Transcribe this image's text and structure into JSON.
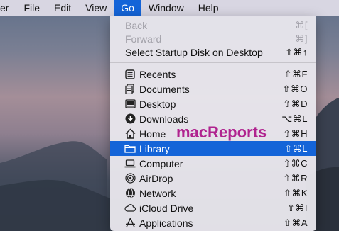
{
  "menubar": {
    "items": [
      {
        "label": "er"
      },
      {
        "label": "File"
      },
      {
        "label": "Edit"
      },
      {
        "label": "View"
      },
      {
        "label": "Go"
      },
      {
        "label": "Window"
      },
      {
        "label": "Help"
      }
    ],
    "active_label": "Go"
  },
  "go_menu": {
    "items": [
      {
        "label": "Back",
        "shortcut": "⌘[",
        "state": "disabled"
      },
      {
        "label": "Forward",
        "shortcut": "⌘]",
        "state": "disabled"
      },
      {
        "label": "Select Startup Disk on Desktop",
        "shortcut": "⇧⌘↑",
        "state": "enabled"
      },
      {
        "label": "Recents",
        "shortcut": "⇧⌘F",
        "icon": "recents-icon"
      },
      {
        "label": "Documents",
        "shortcut": "⇧⌘O",
        "icon": "documents-icon"
      },
      {
        "label": "Desktop",
        "shortcut": "⇧⌘D",
        "icon": "desktop-icon"
      },
      {
        "label": "Downloads",
        "shortcut": "⌥⌘L",
        "icon": "downloads-icon"
      },
      {
        "label": "Home",
        "shortcut": "⇧⌘H",
        "icon": "home-icon"
      },
      {
        "label": "Library",
        "shortcut": "⇧⌘L",
        "icon": "library-folder-icon",
        "state": "selected"
      },
      {
        "label": "Computer",
        "shortcut": "⇧⌘C",
        "icon": "computer-icon"
      },
      {
        "label": "AirDrop",
        "shortcut": "⇧⌘R",
        "icon": "airdrop-icon"
      },
      {
        "label": "Network",
        "shortcut": "⇧⌘K",
        "icon": "network-icon"
      },
      {
        "label": "iCloud Drive",
        "shortcut": "⇧⌘I",
        "icon": "icloud-icon"
      },
      {
        "label": "Applications",
        "shortcut": "⇧⌘A",
        "icon": "applications-icon"
      }
    ]
  },
  "watermark": {
    "text": "macReports"
  },
  "colors": {
    "highlight": "#1464d8",
    "watermark": "#b0238f",
    "disabled_text": "#a3a2aa"
  }
}
